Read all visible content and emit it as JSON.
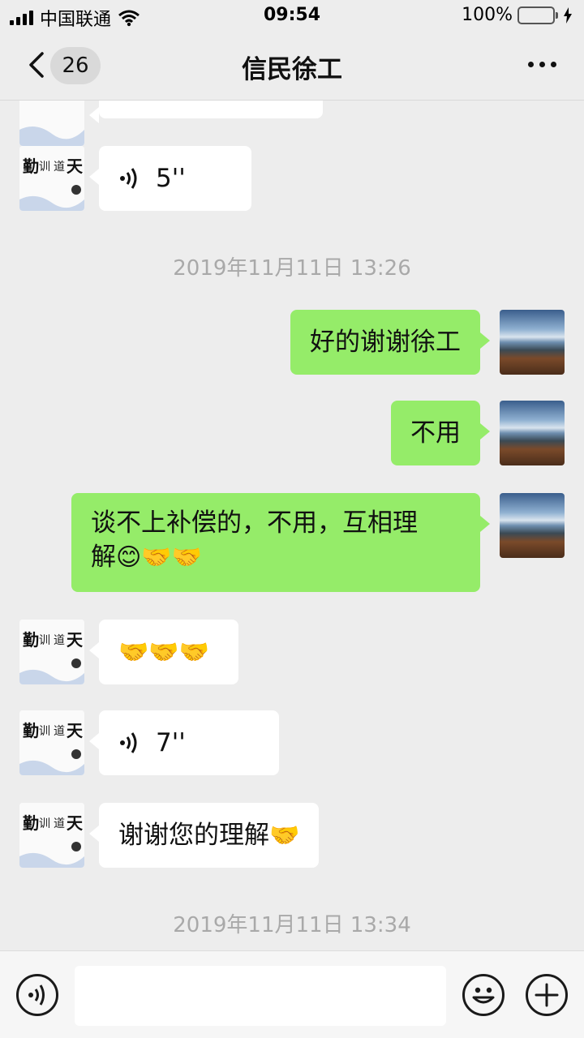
{
  "status_bar": {
    "carrier": "中国联通",
    "time": "09:54",
    "battery": "100%"
  },
  "nav": {
    "unread_count": "26",
    "title": "信民徐工"
  },
  "messages": [
    {
      "type": "voice",
      "side": "in",
      "duration": "5''"
    },
    {
      "type": "timestamp",
      "text": "2019年11月11日 13:26"
    },
    {
      "type": "text",
      "side": "out",
      "text": "好的谢谢徐工"
    },
    {
      "type": "text",
      "side": "out",
      "text": "不用"
    },
    {
      "type": "text",
      "side": "out",
      "line1": "谈不上补偿的，不用，互相理",
      "line2": "解",
      "emojis": "😊🤝🤝"
    },
    {
      "type": "emoji",
      "side": "in",
      "emojis": "🤝🤝🤝"
    },
    {
      "type": "voice",
      "side": "in",
      "duration": "7''"
    },
    {
      "type": "text",
      "side": "in",
      "text": "谢谢您的理解",
      "emojis": "🤝"
    },
    {
      "type": "timestamp",
      "text": "2019年11月11日 13:34"
    }
  ],
  "icons": {
    "back": "chevron-left-icon",
    "more": "more-dots-icon",
    "voice_input": "voice-icon",
    "emoji": "smiley-icon",
    "plus": "plus-icon"
  },
  "colors": {
    "outgoing_bubble": "#95ec69",
    "incoming_bubble": "#ffffff",
    "background": "#ededed"
  }
}
